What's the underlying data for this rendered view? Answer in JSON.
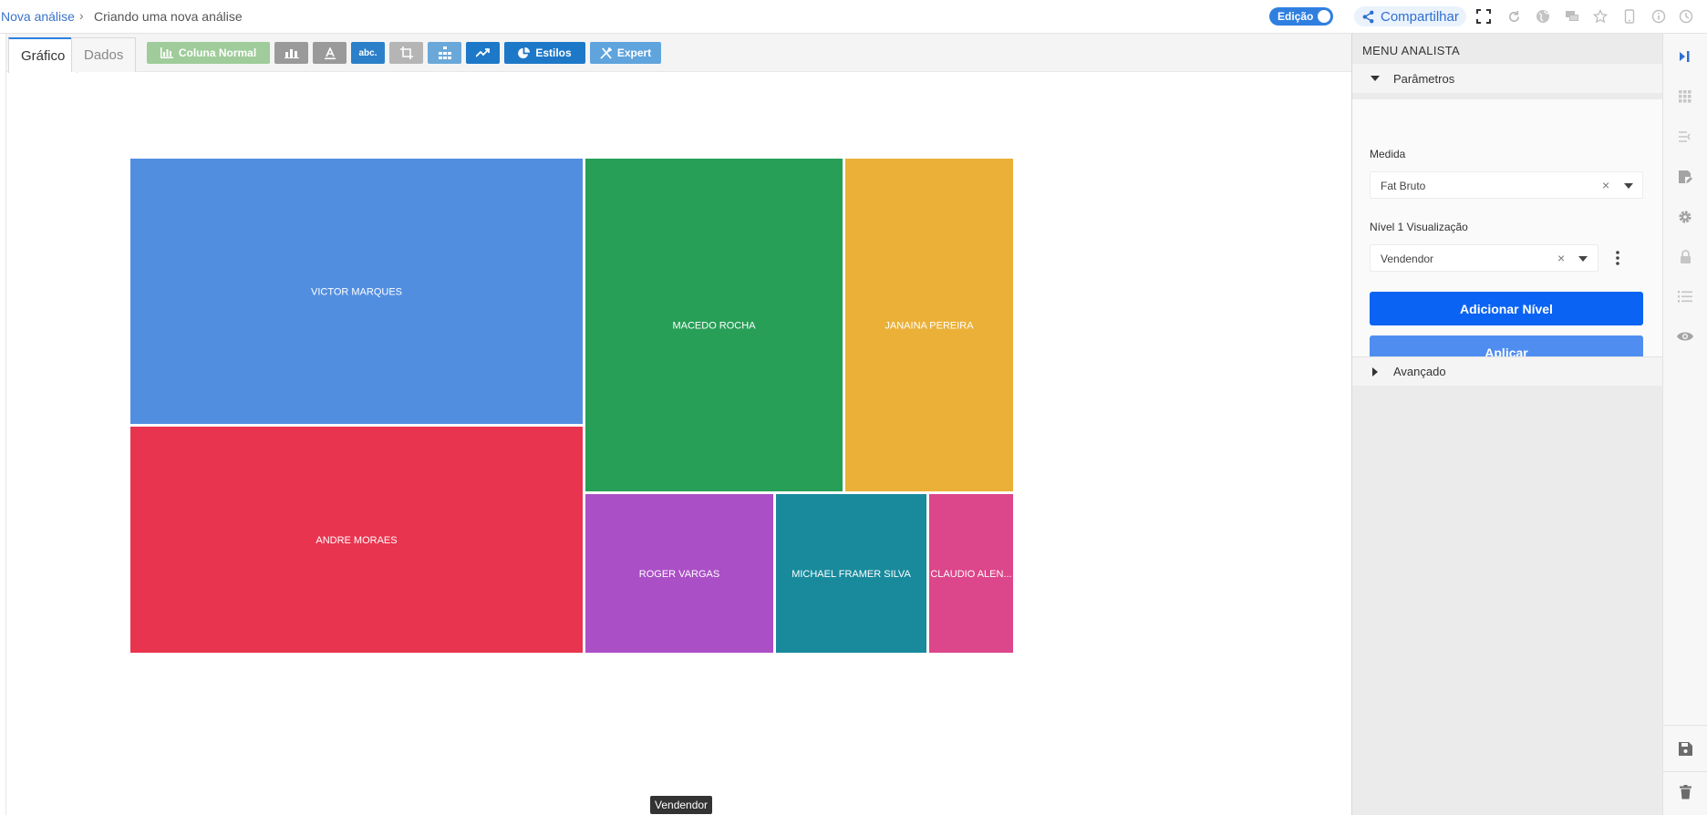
{
  "breadcrumb": {
    "root": "Nova análise",
    "separator": "›",
    "current": "Criando uma nova análise"
  },
  "header": {
    "edit_toggle_label": "Edição",
    "share_label": "Compartilhar"
  },
  "tabs": [
    {
      "label": "Gráfico",
      "active": true
    },
    {
      "label": "Dados",
      "active": false
    }
  ],
  "toolbar": {
    "chart_type_label": "Coluna Normal",
    "abc_label": "abc.",
    "styles_label": "Estilos",
    "expert_label": "Expert"
  },
  "chart_data": {
    "type": "treemap",
    "labels": [
      "VICTOR MARQUES",
      "ANDRE MORAES",
      "MACEDO ROCHA",
      "JANAINA PEREIRA",
      "ROGER VARGAS",
      "MICHAEL FRAMER SILVA",
      "CLAUDIO ALEN..."
    ],
    "colors": [
      "#528ee0",
      "#e9344f",
      "#279f57",
      "#eab038",
      "#ab4fc6",
      "#188a9c",
      "#dc468a"
    ]
  },
  "tooltip": {
    "text": "Vendendor"
  },
  "panel": {
    "title": "MENU ANALISTA",
    "section_params": "Parâmetros",
    "measure_label": "Medida",
    "measure_value": "Fat Bruto",
    "level_label": "Nível 1 Visualização",
    "level_value": "Vendendor",
    "add_level_button": "Adicionar Nível",
    "apply_button": "Aplicar",
    "section_advanced": "Avançado"
  },
  "colors": {
    "accent": "#0a63f3",
    "accent_light": "#4f8ef0",
    "toggle": "#2f7fe0"
  }
}
